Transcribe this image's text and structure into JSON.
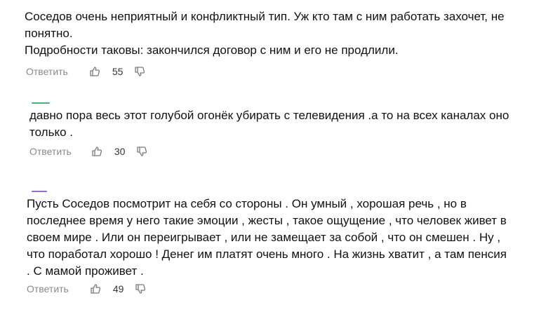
{
  "comments": [
    {
      "text": "Соседов очень неприятный и конфликтный тип. Уж кто там с ним работать захочет, не\nпонятно.\nПодробности таковы: закончился договор с ним и его не продлили.",
      "reply_label": "Ответить",
      "likes": "55"
    },
    {
      "text": "давно пора весь этот голубой огонёк убирать с телевидения .а то на всех каналах оно\nтолько .",
      "reply_label": "Ответить",
      "likes": "30"
    },
    {
      "text": "Пусть Соседов посмотрит на себя со стороны . Он умный , хорошая речь , но в\nпоследнее время у него такие эмоции , жесты , такое ощущение , что человек живет в\nсвоем мире . Или он переигрывает , или не замещает за собой , что он смешен . Ну ,\nчто поработал хорошо ! Денег им платят очень много . На жизнь хватит , а там пенсия\n. С мамой проживет .",
      "reply_label": "Ответить",
      "likes": "49"
    }
  ],
  "colors": {
    "avatar_green": "#4caf7d",
    "avatar_purple": "#8e6cc9",
    "muted_text": "#8a8a8a"
  },
  "icons": {
    "like": "thumbs-up-icon",
    "dislike": "thumbs-down-icon"
  }
}
